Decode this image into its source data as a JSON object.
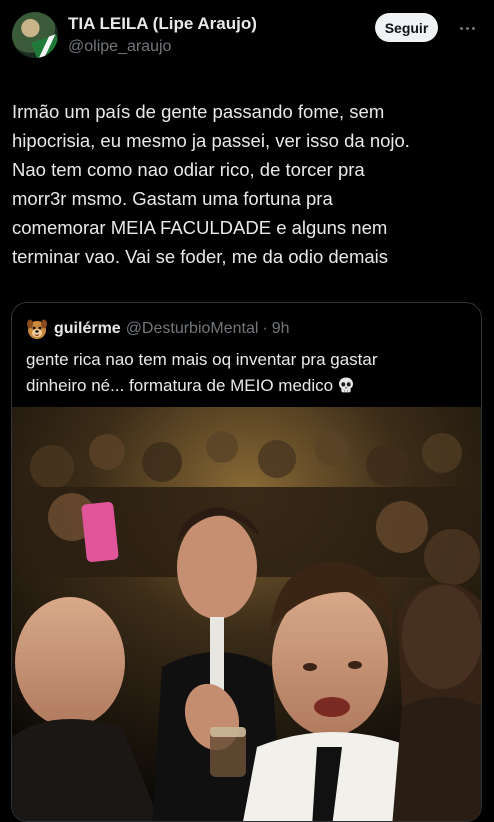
{
  "tweet": {
    "author": {
      "display_name": "TIA LEILA (Lipe Araujo)",
      "handle": "@olipe_araujo",
      "avatar_icon": "profile-photo"
    },
    "follow_label": "Seguir",
    "more_icon": "more-dots-icon",
    "text_lines": [
      "Irmão um país de gente passando fome, sem",
      "hipocrisia, eu mesmo ja passei, ver isso da nojo.",
      "Nao tem como nao odiar rico, de torcer pra",
      "morr3r msmo. Gastam uma fortuna pra",
      "comemorar MEIA FACULDADE e alguns nem",
      "terminar vao. Vai se foder, me da odio demais"
    ]
  },
  "quote": {
    "author": {
      "display_name": "guilérme",
      "handle": "@DesturbioMental",
      "separator": "·",
      "time": "9h",
      "avatar_icon": "cartoon-dog-avatar"
    },
    "text_lines": [
      "gente rica nao tem mais oq inventar pra gastar",
      "dinheiro né... formatura de MEIO medico"
    ],
    "emoji": "skull-emoji",
    "media": {
      "type": "video-still",
      "description_icon": "party-crowd-photo"
    }
  },
  "colors": {
    "background": "#000000",
    "text_primary": "#e7e9ea",
    "text_secondary": "#71767b",
    "border": "#2f3336",
    "follow_bg": "#eff3f4",
    "follow_text": "#0f1419"
  }
}
